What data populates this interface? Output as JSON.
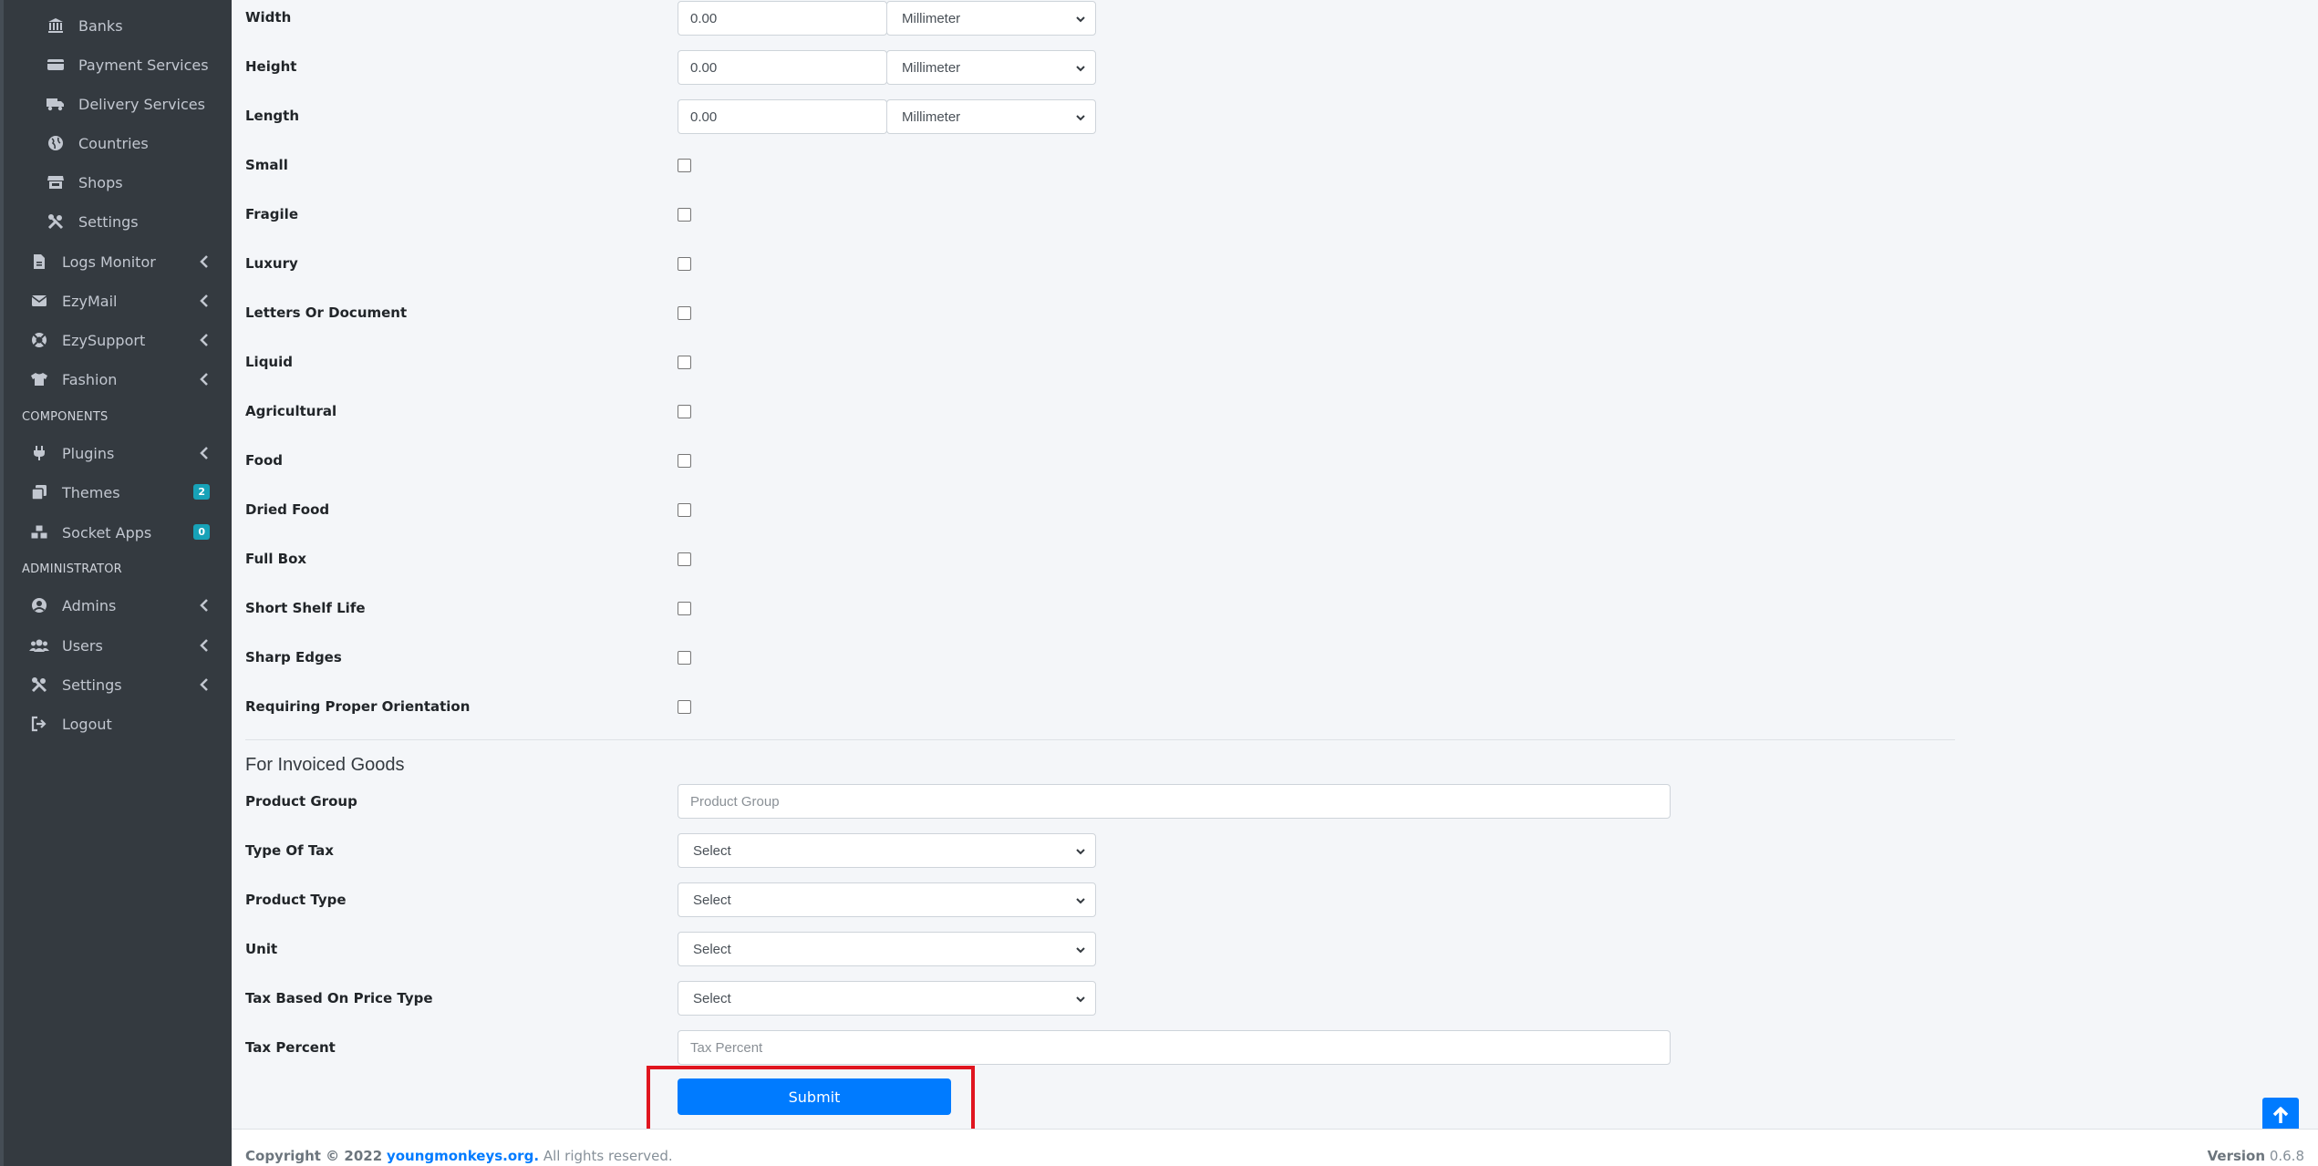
{
  "sidebar": {
    "sub_items": [
      {
        "label": "Banks",
        "icon": "bank-icon"
      },
      {
        "label": "Payment Services",
        "icon": "credit-card-icon"
      },
      {
        "label": "Delivery Services",
        "icon": "truck-icon"
      },
      {
        "label": "Countries",
        "icon": "globe-icon"
      },
      {
        "label": "Shops",
        "icon": "store-icon"
      },
      {
        "label": "Settings",
        "icon": "tools-icon"
      }
    ],
    "items": [
      {
        "label": "Logs Monitor",
        "icon": "file-icon"
      },
      {
        "label": "EzyMail",
        "icon": "envelope-icon"
      },
      {
        "label": "EzySupport",
        "icon": "lifebuoy-icon"
      },
      {
        "label": "Fashion",
        "icon": "tshirt-icon"
      }
    ],
    "components_header": "COMPONENTS",
    "components": [
      {
        "label": "Plugins",
        "icon": "plug-icon"
      },
      {
        "label": "Themes",
        "icon": "clone-icon",
        "badge": "2"
      },
      {
        "label": "Socket Apps",
        "icon": "cubes-icon",
        "badge": "0"
      }
    ],
    "admin_header": "ADMINISTRATOR",
    "admin": [
      {
        "label": "Admins",
        "icon": "user-circle-icon"
      },
      {
        "label": "Users",
        "icon": "users-icon"
      },
      {
        "label": "Settings",
        "icon": "tools-icon"
      },
      {
        "label": "Logout",
        "icon": "sign-out-icon"
      }
    ]
  },
  "dimensions": [
    {
      "label": "Width",
      "value": "0.00",
      "unit": "Millimeter"
    },
    {
      "label": "Height",
      "value": "0.00",
      "unit": "Millimeter"
    },
    {
      "label": "Length",
      "value": "0.00",
      "unit": "Millimeter"
    }
  ],
  "checkboxes": [
    "Small",
    "Fragile",
    "Luxury",
    "Letters Or Document",
    "Liquid",
    "Agricultural",
    "Food",
    "Dried Food",
    "Full Box",
    "Short Shelf Life",
    "Sharp Edges",
    "Requiring Proper Orientation"
  ],
  "invoiced": {
    "title": "For Invoiced Goods",
    "product_group_label": "Product Group",
    "product_group_placeholder": "Product Group",
    "type_of_tax_label": "Type Of Tax",
    "type_of_tax_value": "Select",
    "product_type_label": "Product Type",
    "product_type_value": "Select",
    "unit_label": "Unit",
    "unit_value": "Select",
    "tax_based_label": "Tax Based On Price Type",
    "tax_based_value": "Select",
    "tax_percent_label": "Tax Percent",
    "tax_percent_placeholder": "Tax Percent"
  },
  "submit_label": "Submit",
  "footer": {
    "copyright": "Copyright © 2022",
    "link": "youngmonkeys.org.",
    "rights": "All rights reserved.",
    "version_label": "Version",
    "version": "0.6.8"
  },
  "colors": {
    "primary": "#007bff",
    "sidebar_bg": "#343a40",
    "highlight": "#e0151f"
  }
}
